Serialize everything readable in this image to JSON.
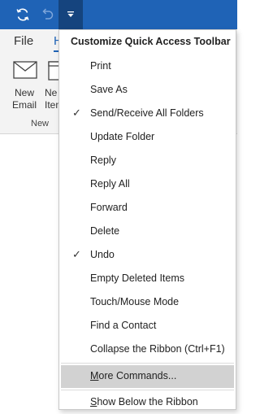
{
  "tabs": {
    "file": "File",
    "home": "Home"
  },
  "ribbon": {
    "new_email_label": "New\nEmail",
    "new_item_label": "New\nItems",
    "group_label": "New"
  },
  "menu": {
    "header": "Customize Quick Access Toolbar",
    "items": [
      {
        "label": "Print",
        "checked": false
      },
      {
        "label": "Save As",
        "checked": false
      },
      {
        "label": "Send/Receive All Folders",
        "checked": true
      },
      {
        "label": "Update Folder",
        "checked": false
      },
      {
        "label": "Reply",
        "checked": false
      },
      {
        "label": "Reply All",
        "checked": false
      },
      {
        "label": "Forward",
        "checked": false
      },
      {
        "label": "Delete",
        "checked": false
      },
      {
        "label": "Undo",
        "checked": true
      },
      {
        "label": "Empty Deleted Items",
        "checked": false
      },
      {
        "label": "Touch/Mouse Mode",
        "checked": false
      },
      {
        "label": "Find a Contact",
        "checked": false
      },
      {
        "label": "Collapse the Ribbon (Ctrl+F1)",
        "checked": false
      }
    ],
    "more_commands_prefix": "M",
    "more_commands_rest": "ore Commands...",
    "show_below_prefix": "S",
    "show_below_rest": "how Below the Ribbon",
    "check_glyph": "✓"
  },
  "colors": {
    "titlebar": "#1f63b6",
    "accent": "#1f63b6",
    "hover": "#d2d2d2"
  }
}
